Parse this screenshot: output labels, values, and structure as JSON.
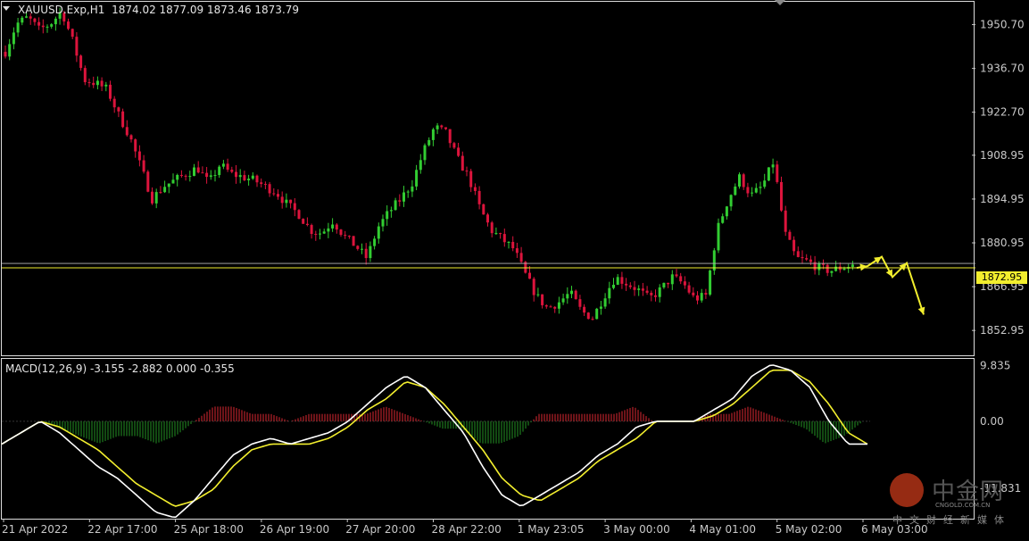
{
  "header": {
    "symbol": "XAUUSD.Exp,H1",
    "ohlc": "1874.02 1877.09 1873.46 1873.79"
  },
  "macd_header": "MACD(12,26,9) -3.155 -2.882 0.000 -0.355",
  "price_tag": "1872.95",
  "watermark": {
    "title": "中金网",
    "sub": "CNGOLD.COM.CN",
    "cn": "中文财经新媒体"
  },
  "colors": {
    "background": "#000000",
    "bull": "#32cd32",
    "bear": "#dc143c",
    "signal": "#f2ee2e",
    "macd_line": "#ffffff",
    "hist_up": "#b8212a",
    "hist_down": "#1e7a1e",
    "axis": "#c8c8c8"
  },
  "chart_data": [
    {
      "type": "candlestick",
      "symbol": "XAUUSD.Exp",
      "timeframe": "H1",
      "ylim": [
        1845,
        1958
      ],
      "y_ticks": [
        "1950.70",
        "1936.70",
        "1922.70",
        "1908.95",
        "1894.95",
        "1880.95",
        "1866.95",
        "1852.95"
      ],
      "x_ticks": [
        "21 Apr 2022",
        "22 Apr 17:00",
        "25 Apr 18:00",
        "26 Apr 19:00",
        "27 Apr 20:00",
        "28 Apr 22:00",
        "1 May 23:05",
        "3 May 00:00",
        "4 May 01:00",
        "5 May 02:00",
        "6 May 03:00"
      ],
      "current_price": 1872.95,
      "close_path": [
        1942,
        1951,
        1953,
        1949,
        1951,
        1955,
        1945,
        1933,
        1932,
        1930,
        1922,
        1915,
        1905,
        1895,
        1899,
        1901,
        1903,
        1905,
        1900,
        1906,
        1903,
        1902,
        1901,
        1899,
        1897,
        1893,
        1890,
        1885,
        1884,
        1888,
        1883,
        1880,
        1876,
        1886,
        1891,
        1895,
        1900,
        1910,
        1918,
        1916,
        1908,
        1902,
        1892,
        1885,
        1882,
        1879,
        1871,
        1864,
        1860,
        1862,
        1865,
        1859,
        1857,
        1864,
        1870,
        1868,
        1866,
        1863,
        1866,
        1870,
        1868,
        1863,
        1864,
        1885,
        1895,
        1902,
        1896,
        1899,
        1907,
        1884,
        1876,
        1875,
        1873,
        1872,
        1873,
        1874
      ],
      "projection": [
        1873.5,
        1876.5,
        1870,
        1874.5,
        1858
      ]
    },
    {
      "type": "macd",
      "params": [
        12,
        26,
        9
      ],
      "values": {
        "macd": -3.155,
        "signal": -2.882,
        "histogram": 0.0,
        "value4": -0.355
      },
      "ylim": [
        -17,
        11
      ],
      "y_ticks": [
        "9.835",
        "0.00",
        "-11.831"
      ],
      "macd_path": [
        -4,
        -2,
        0,
        -2,
        -5,
        -8,
        -10,
        -13,
        -16,
        -17,
        -14,
        -10,
        -6,
        -4,
        -3,
        -4,
        -3,
        -2,
        0,
        3,
        6,
        8,
        6,
        2,
        -2,
        -8,
        -13,
        -15,
        -13,
        -11,
        -9,
        -6,
        -4,
        -1,
        0,
        0,
        0,
        2,
        4,
        8,
        10,
        9,
        6,
        0,
        -4,
        -4
      ],
      "signal_path": [
        -4,
        -2,
        0,
        -1,
        -3,
        -5,
        -8,
        -11,
        -13,
        -15,
        -14,
        -12,
        -8,
        -5,
        -4,
        -4,
        -4,
        -3,
        -1,
        2,
        4,
        7,
        6,
        3,
        -1,
        -5,
        -10,
        -13,
        -14,
        -12,
        -10,
        -7,
        -5,
        -3,
        0,
        0,
        0,
        1,
        3,
        6,
        9,
        9,
        7,
        3,
        -2,
        -4
      ]
    }
  ]
}
